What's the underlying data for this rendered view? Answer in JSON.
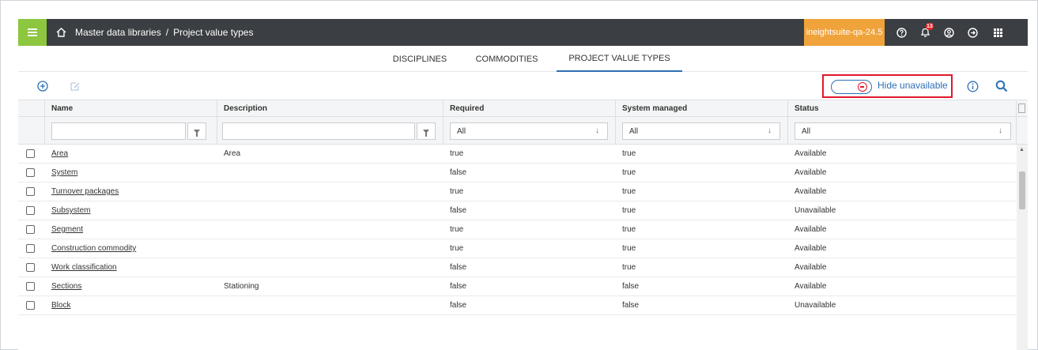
{
  "topbar": {
    "breadcrumb_root": "Master data libraries",
    "breadcrumb_separator": "/",
    "breadcrumb_current": "Project value types",
    "environment": "ineightsuite-qa-24.5",
    "notification_count": "13",
    "brand_color": "#8dc63f",
    "env_color": "#f0a33a"
  },
  "tabs": [
    {
      "label": "DISCIPLINES",
      "active": false
    },
    {
      "label": "COMMODITIES",
      "active": false
    },
    {
      "label": "PROJECT VALUE TYPES",
      "active": true
    }
  ],
  "toolbar": {
    "toggle_label": "Hide unavailable",
    "accent_color": "#2f6fb5",
    "highlight_color": "#e3162c"
  },
  "grid": {
    "columns": [
      "Name",
      "Description",
      "Required",
      "System managed",
      "Status"
    ],
    "filters": {
      "name": "",
      "description": "",
      "required": "All",
      "system_managed": "All",
      "status": "All"
    },
    "rows": [
      {
        "name": "Area",
        "description": "Area",
        "required": "true",
        "system_managed": "true",
        "status": "Available"
      },
      {
        "name": "System",
        "description": "",
        "required": "false",
        "system_managed": "true",
        "status": "Available"
      },
      {
        "name": "Turnover packages",
        "description": "",
        "required": "true",
        "system_managed": "true",
        "status": "Available"
      },
      {
        "name": "Subsystem",
        "description": "",
        "required": "false",
        "system_managed": "true",
        "status": "Unavailable"
      },
      {
        "name": "Segment",
        "description": "",
        "required": "true",
        "system_managed": "true",
        "status": "Available"
      },
      {
        "name": "Construction commodity",
        "description": "",
        "required": "true",
        "system_managed": "true",
        "status": "Available"
      },
      {
        "name": "Work classification",
        "description": "",
        "required": "false",
        "system_managed": "true",
        "status": "Available"
      },
      {
        "name": "Sections",
        "description": "Stationing",
        "required": "false",
        "system_managed": "false",
        "status": "Available"
      },
      {
        "name": "Block",
        "description": "",
        "required": "false",
        "system_managed": "false",
        "status": "Unavailable"
      }
    ]
  }
}
